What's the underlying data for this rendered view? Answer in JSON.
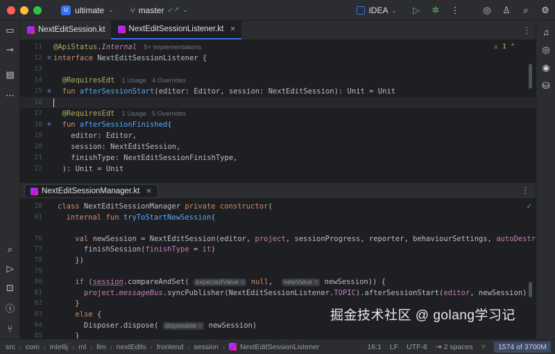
{
  "titlebar": {
    "project_badge": "U",
    "project_name": "ultimate",
    "branch": "master",
    "run_config": "IDEA",
    "lights": [
      "#ff5f57",
      "#febc2e",
      "#28c840"
    ]
  },
  "tabs": [
    {
      "label": "NextEditSession.kt",
      "active": false
    },
    {
      "label": "NextEditSessionListener.kt",
      "active": true
    }
  ],
  "top_editor": {
    "warnings_count": "1",
    "lines": [
      {
        "n": "11",
        "segments": [
          [
            "an",
            "@ApiStatus."
          ],
          [
            "it",
            "Internal"
          ]
        ],
        "hint": "5+ Implementations"
      },
      {
        "n": "12",
        "segments": [
          [
            "kw",
            "interface "
          ],
          [
            "plain",
            "NextEditSessionListener {"
          ]
        ]
      },
      {
        "n": "13",
        "segments": []
      },
      {
        "n": "14",
        "segments": [
          [
            "an",
            "  @RequiresEdt"
          ]
        ],
        "hint": "1 Usage   4 Overrides"
      },
      {
        "n": "15",
        "segments": [
          [
            "kw",
            "  fun "
          ],
          [
            "fn",
            "afterSessionStart"
          ],
          [
            "plain",
            "(editor: Editor, session: NextEditSession): Unit = Unit"
          ]
        ]
      },
      {
        "n": "16",
        "segments": [],
        "current": true
      },
      {
        "n": "17",
        "segments": [
          [
            "an",
            "  @RequiresEdt"
          ]
        ],
        "hint": "1 Usage   5 Overrides"
      },
      {
        "n": "18",
        "segments": [
          [
            "kw",
            "  fun "
          ],
          [
            "fn",
            "afterSessionFinished"
          ],
          [
            "plain",
            "("
          ]
        ]
      },
      {
        "n": "19",
        "segments": [
          [
            "plain",
            "    editor: Editor,"
          ]
        ]
      },
      {
        "n": "20",
        "segments": [
          [
            "plain",
            "    session: NextEditSession,"
          ]
        ]
      },
      {
        "n": "21",
        "segments": [
          [
            "plain",
            "    finishType: NextEditSessionFinishType,"
          ]
        ]
      },
      {
        "n": "22",
        "segments": [
          [
            "plain",
            "  ): Unit = Unit"
          ]
        ]
      }
    ]
  },
  "bottom_editor": {
    "tab_label": "NextEditSessionManager.kt",
    "lines": [
      {
        "n": "28",
        "html": "<span class=\"kw\">class </span>NextEditSessionManager <span class=\"kw\">private constructor</span>("
      },
      {
        "n": "61",
        "html": "  <span class=\"kw\">internal fun </span><span class=\"fn\">tryToStartNewSession</span>("
      },
      {
        "n": "",
        "html": ""
      },
      {
        "n": "76",
        "html": "    <span class=\"kw\">val </span>newSession = NextEditSession(editor, <span class=\"pr\">project</span>, sessionProgress, reporter, behaviourSettings, <span class=\"pr\">autoDestroy</span> = {"
      },
      {
        "n": "77",
        "html": "      finishSession(<span class=\"pr\">finishType</span> = <span class=\"kw\">it</span>)"
      },
      {
        "n": "78",
        "html": "    })"
      },
      {
        "n": "79",
        "html": ""
      },
      {
        "n": "80",
        "html": "    <span class=\"kw\">if </span>(<span class=\"pr ul\">session</span>.compareAndSet( <span class=\"inlay\">expectedValue =</span> <span class=\"kw\">null</span>,  <span class=\"inlay\">newValue =</span> newSession)) {"
      },
      {
        "n": "81",
        "html": "      <span class=\"pr\">project</span>.<span class=\"it\">messageBus</span>.syncPublisher(NextEditSessionListener.<span class=\"pr\">TOPIC</span>).afterSessionStart(<span class=\"pr\">editor</span>, newSession)"
      },
      {
        "n": "82",
        "html": "    }"
      },
      {
        "n": "83",
        "html": "    <span class=\"kw\">else </span>{"
      },
      {
        "n": "84",
        "html": "      Disposer.dispose( <span class=\"inlay\">disposable =</span> newSession)"
      },
      {
        "n": "85",
        "html": "    }"
      }
    ]
  },
  "statusbar": {
    "breadcrumbs": [
      "src",
      "com",
      "intellij",
      "ml",
      "llm",
      "nextEdits",
      "frontend",
      "session",
      "NextEditSessionListener"
    ],
    "position": "16:1",
    "line_sep": "LF",
    "encoding": "UTF-8",
    "indent": "2 spaces",
    "memory": "1574 of 3700M"
  },
  "watermark": "掘金技术社区 @ golang学习记"
}
